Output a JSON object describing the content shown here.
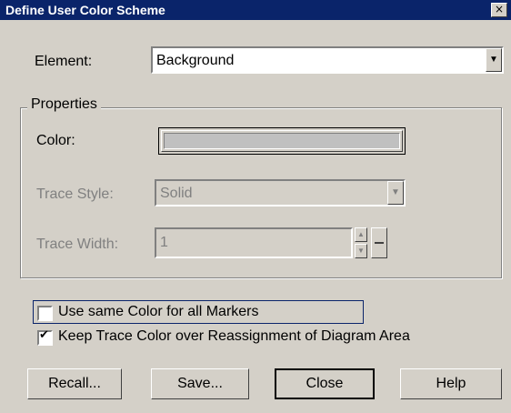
{
  "window": {
    "title": "Define User Color Scheme",
    "close_glyph": "×"
  },
  "element": {
    "label": "Element:",
    "value": "Background",
    "dropdown_glyph": "▼"
  },
  "properties": {
    "group_label": "Properties",
    "color_label": "Color:",
    "trace_style_label": "Trace Style:",
    "trace_style_value": "Solid",
    "trace_width_label": "Trace Width:",
    "trace_width_value": "1",
    "spin_up_glyph": "▲",
    "spin_down_glyph": "▼",
    "swatch_color": "#c0c0c0"
  },
  "checkboxes": [
    {
      "label": "Use same Color for all Markers",
      "checked": false,
      "mark": ""
    },
    {
      "label": "Keep Trace Color over Reassignment of Diagram Area",
      "checked": true,
      "mark": "✔"
    }
  ],
  "buttons": {
    "recall": "Recall...",
    "save": "Save...",
    "close": "Close",
    "help": "Help"
  },
  "colors": {
    "titlebar": "#0a246a",
    "dialog_bg": "#d4d0c8"
  }
}
